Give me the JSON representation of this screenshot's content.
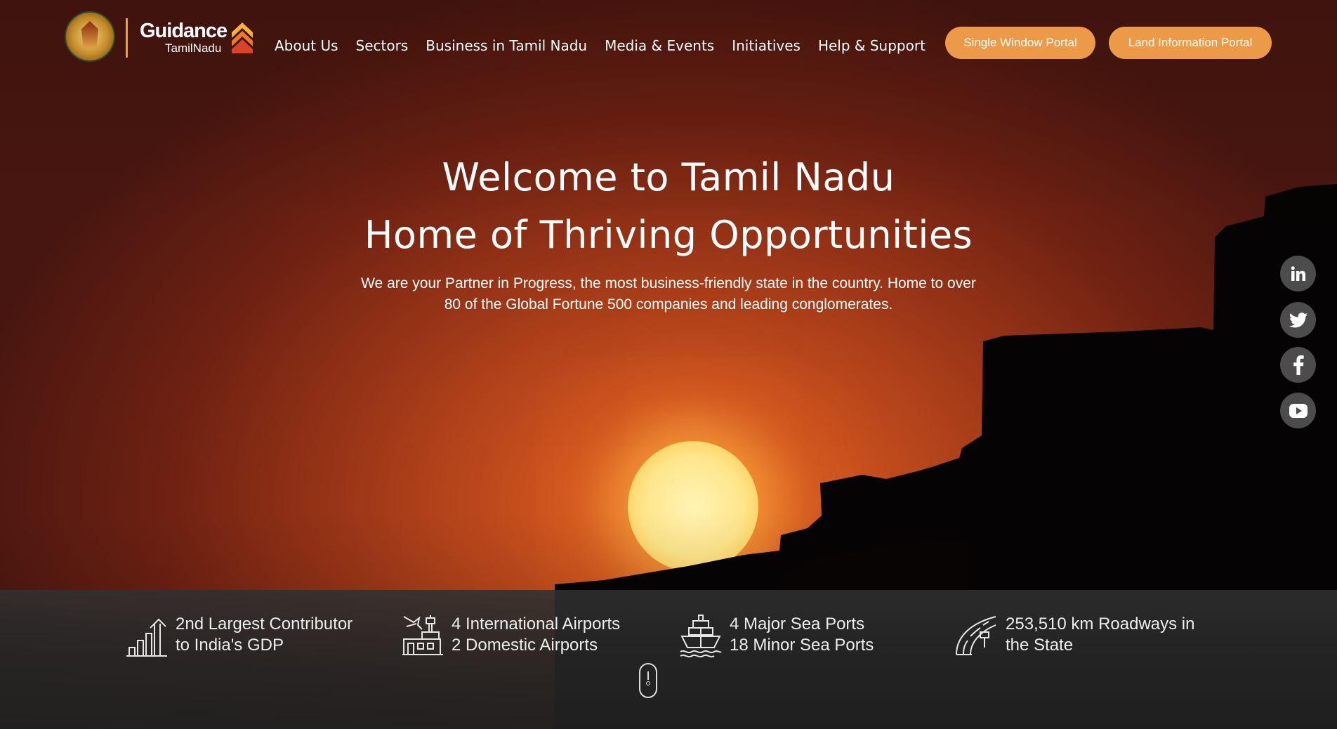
{
  "logo": {
    "emblem": "tamil-nadu-government-emblem",
    "brand": "Guidance",
    "sub": "TamilNadu"
  },
  "nav": {
    "items": [
      "About Us",
      "Sectors",
      "Business in Tamil Nadu",
      "Media & Events",
      "Initiatives",
      "Help & Support"
    ]
  },
  "buttons": {
    "single_window": "Single Window Portal",
    "land_info": "Land Information Portal"
  },
  "hero": {
    "title_line1": "Welcome to Tamil Nadu",
    "title_line2": "Home of Thriving Opportunities",
    "description": "We are your Partner in Progress, the most business-friendly state in the country. Home to over 80 of the Global Fortune 500 companies and leading conglomerates."
  },
  "social": [
    "linkedin-icon",
    "twitter-icon",
    "facebook-icon",
    "youtube-icon"
  ],
  "stats": [
    {
      "icon": "growth-chart-icon",
      "line1": "2nd Largest Contributor",
      "line2": "to India's GDP"
    },
    {
      "icon": "airport-icon",
      "line1": "4 International Airports",
      "line2": "2 Domestic Airports"
    },
    {
      "icon": "ship-icon",
      "line1": "4 Major Sea Ports",
      "line2": "18 Minor Sea Ports"
    },
    {
      "icon": "road-icon",
      "line1": "253,510 km Roadways in",
      "line2": "the State"
    }
  ],
  "colors": {
    "accent": "#ec9a48",
    "social_bg": "#4c4c4c",
    "stats_bg": "#2a2a2a"
  }
}
